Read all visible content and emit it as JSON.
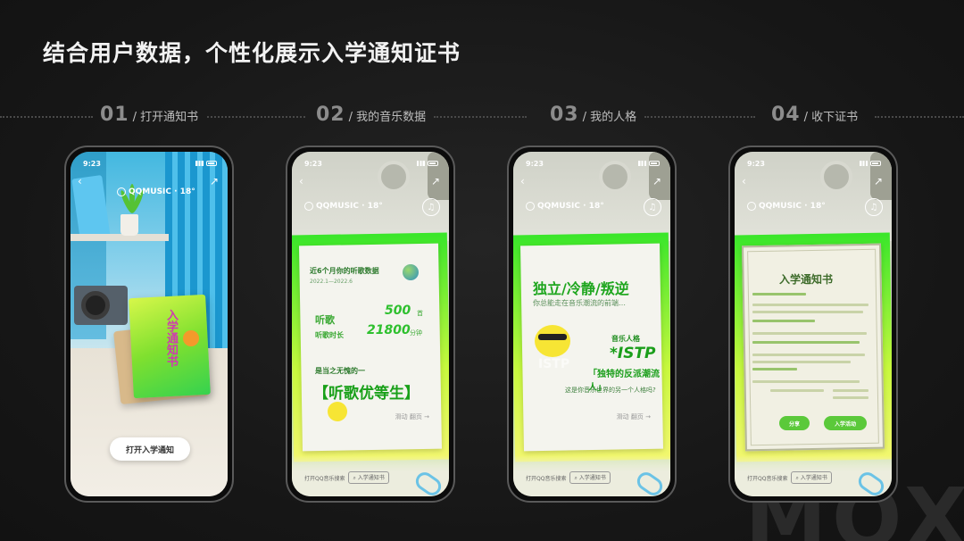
{
  "title": "结合用户数据，个性化展示入学通知证书",
  "watermark": "MOX",
  "steps": [
    {
      "num": "01",
      "label": "/ 打开通知书"
    },
    {
      "num": "02",
      "label": "/ 我的音乐数据"
    },
    {
      "num": "03",
      "label": "/ 我的人格"
    },
    {
      "num": "04",
      "label": "/ 收下证书"
    }
  ],
  "phone_common": {
    "time": "9:23",
    "brand": "QQMUSIC · 18°",
    "back_glyph": "‹",
    "share_glyph": "↗",
    "music_glyph": "♫",
    "footer_left": "打开QQ音乐搜索",
    "footer_search": "入学通知书",
    "share_text": "滑动 翻页 →"
  },
  "phone1": {
    "book_title": "入学通知书",
    "cta": "打开入学通知"
  },
  "phone2": {
    "header": "近6个月你的听歌数据",
    "sub": "2022.1—2022.6",
    "row1_label": "听歌",
    "row1_value": "500",
    "row1_unit": "首",
    "row2_label": "听歌时长",
    "row2_value": "21800",
    "row2_unit": "分钟",
    "question": "是当之无愧的一",
    "result": "【听歌优等生】"
  },
  "phone3": {
    "headline": "独立/冷静/叛逆",
    "sub": "你总能走在音乐潮流的前端…",
    "personality_label": "音乐人格",
    "type": "*ISTP",
    "tag": "「独特的反派潮流人」",
    "question": "这是你音乐世界的另一个人格吗?",
    "faint": "ISTP"
  },
  "phone4": {
    "doc_title": "入学通知书",
    "btn_share": "分享",
    "btn_activity": "入学活动"
  }
}
